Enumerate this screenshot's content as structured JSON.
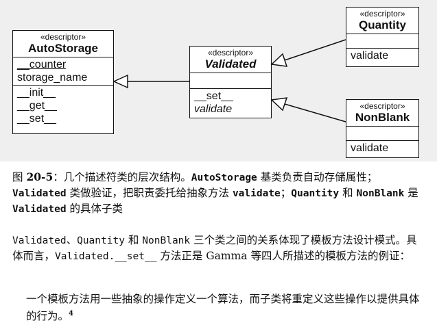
{
  "diagram": {
    "autostorage": {
      "stereotype": "«descriptor»",
      "name": "AutoStorage",
      "attributes": [
        "__counter",
        "storage_name"
      ],
      "methods": [
        "__init__",
        "__get__",
        "__set__"
      ]
    },
    "validated": {
      "stereotype": "«descriptor»",
      "name": "Validated",
      "methods": [
        "__set__",
        "validate"
      ]
    },
    "quantity": {
      "stereotype": "«descriptor»",
      "name": "Quantity",
      "methods": [
        "validate"
      ]
    },
    "nonblank": {
      "stereotype": "«descriptor»",
      "name": "NonBlank",
      "methods": [
        "validate"
      ]
    }
  },
  "caption": {
    "prefix": "图 ",
    "figure_no": "20-5",
    "t1": "：几个描述符类的层次结构。",
    "c1": "AutoStorage",
    "t2": " 基类负责自动存储属性；",
    "c2": "Validated",
    "t3": " 类做验证，把职责委托给抽象方法 ",
    "c3": "validate",
    "t4": "；",
    "c4": "Quantity",
    "t5": " 和 ",
    "c5": "NonBlank",
    "t6": " 是 ",
    "c6": "Validated",
    "t7": " 的具体子类"
  },
  "paragraph": {
    "c1": "Validated",
    "t1": "、",
    "c2": "Quantity",
    "t2": " 和 ",
    "c3": "NonBlank",
    "t3": " 三个类之间的关系体现了模板方法设计模式。具体而言，",
    "c4": "Validated.__set__",
    "t4": " 方法正是 Gamma 等四人所描述的模板方法的例证："
  },
  "quote": {
    "text": "一个模板方法用一些抽象的操作定义一个算法，而子类将重定义这些操作以提供具体的行为。",
    "footnote": "4"
  }
}
